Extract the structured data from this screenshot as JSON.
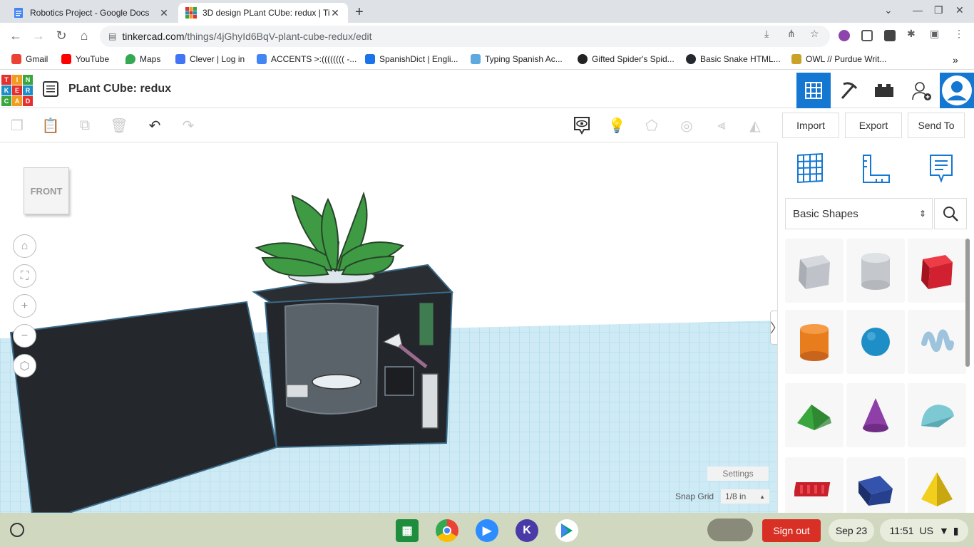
{
  "browser": {
    "tabs": [
      {
        "title": "Robotics Project - Google Docs",
        "active": false
      },
      {
        "title": "3D design PLant CUbe: redux | Ti",
        "active": true
      }
    ],
    "url_host": "tinkercad.com",
    "url_path": "/things/4jGhyId6BqV-plant-cube-redux/edit",
    "bookmarks": [
      "Gmail",
      "YouTube",
      "Maps",
      "Clever | Log in",
      "ACCENTS >:(((((((( -...",
      "SpanishDict | Engli...",
      "Typing Spanish Ac...",
      "Gifted Spider's Spid...",
      "Basic Snake HTML...",
      "OWL // Purdue Writ..."
    ]
  },
  "app": {
    "logo_letters": [
      "T",
      "I",
      "N",
      "K",
      "E",
      "R",
      "C",
      "A",
      "D"
    ],
    "design_title": "PLant CUbe: redux",
    "header_buttons": [
      "grid-view",
      "build",
      "bricks",
      "add-user",
      "profile"
    ]
  },
  "edit_toolbar": {
    "import_label": "Import",
    "export_label": "Export",
    "send_to_label": "Send To"
  },
  "workplane": {
    "viewcube_label": "FRONT",
    "settings_label": "Settings",
    "snap_grid_label": "Snap Grid",
    "snap_grid_value": "1/8 in"
  },
  "panel": {
    "category": "Basic Shapes",
    "shapes": [
      {
        "name": "box-hole",
        "color": "#b8bcc4"
      },
      {
        "name": "cylinder-hole",
        "color": "#c4c8cc"
      },
      {
        "name": "box",
        "color": "#d1202f"
      },
      {
        "name": "cylinder",
        "color": "#e87d1e"
      },
      {
        "name": "sphere",
        "color": "#1e8fc6"
      },
      {
        "name": "scribble",
        "color": "#9ec3dc"
      },
      {
        "name": "roof",
        "color": "#3aa63e"
      },
      {
        "name": "cone",
        "color": "#8e3fa8"
      },
      {
        "name": "round-roof",
        "color": "#7cc9d4"
      },
      {
        "name": "text",
        "color": "#c8202a"
      },
      {
        "name": "wedge",
        "color": "#26408e"
      },
      {
        "name": "pyramid",
        "color": "#f2cf1c"
      }
    ]
  },
  "shelf": {
    "sign_out": "Sign out",
    "date": "Sep 23",
    "time": "11:51",
    "locale": "US"
  }
}
